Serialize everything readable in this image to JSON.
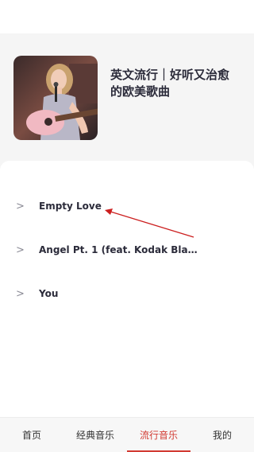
{
  "playlist": {
    "title": "英文流行｜好听又治愈的欧美歌曲"
  },
  "songs": [
    {
      "name": "Empty Love"
    },
    {
      "name": "Angel Pt. 1 (feat. Kodak Blac…"
    },
    {
      "name": "You"
    }
  ],
  "song_chevron": ">",
  "tabs": [
    {
      "label": "首页",
      "active": false
    },
    {
      "label": "经典音乐",
      "active": false
    },
    {
      "label": "流行音乐",
      "active": true
    },
    {
      "label": "我的",
      "active": false
    }
  ],
  "colors": {
    "accent": "#d23a32",
    "annotation": "#cc1f1f"
  }
}
